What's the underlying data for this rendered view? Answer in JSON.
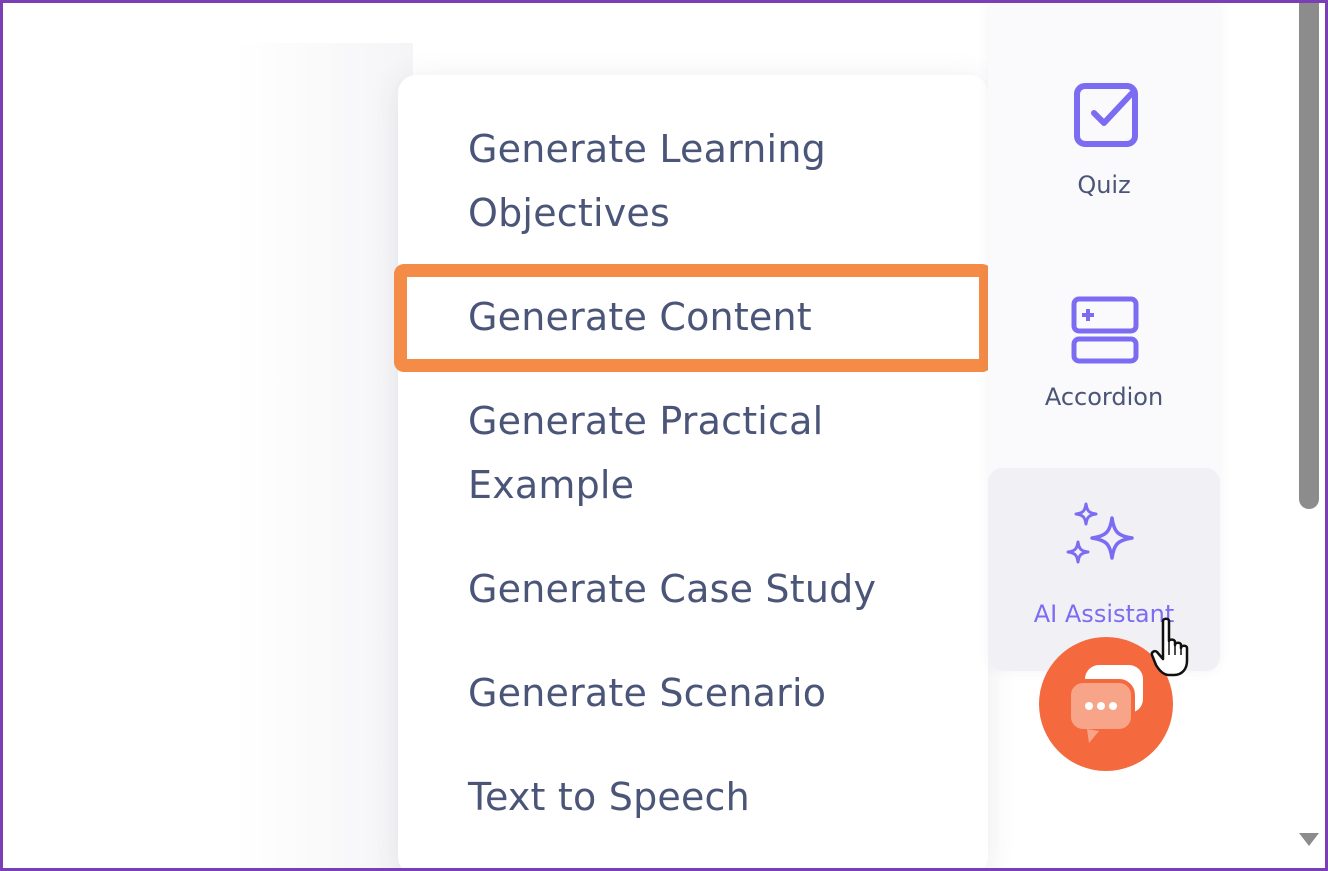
{
  "menu": {
    "items": [
      {
        "lines": [
          "Generate Learning",
          "Objectives"
        ]
      },
      {
        "lines": [
          "Generate Content"
        ]
      },
      {
        "lines": [
          "Generate Practical",
          "Example"
        ]
      },
      {
        "lines": [
          "Generate Case Study"
        ]
      },
      {
        "lines": [
          "Generate Scenario"
        ]
      },
      {
        "lines": [
          "Text to Speech"
        ]
      }
    ],
    "highlighted_index": 1
  },
  "panel": {
    "items": [
      {
        "label": "Quiz",
        "icon": "checkbox-icon"
      },
      {
        "label": "Accordion",
        "icon": "accordion-icon"
      },
      {
        "label": "AI Assistant",
        "icon": "sparkles-icon",
        "active": true
      }
    ]
  },
  "chat": {
    "icon": "chat-bubble-icon"
  },
  "colors": {
    "frame_border": "#7b3fb5",
    "menu_text": "#4a5578",
    "highlight": "#f48b47",
    "accent": "#7b6cf2",
    "chat_button": "#f5693e"
  }
}
